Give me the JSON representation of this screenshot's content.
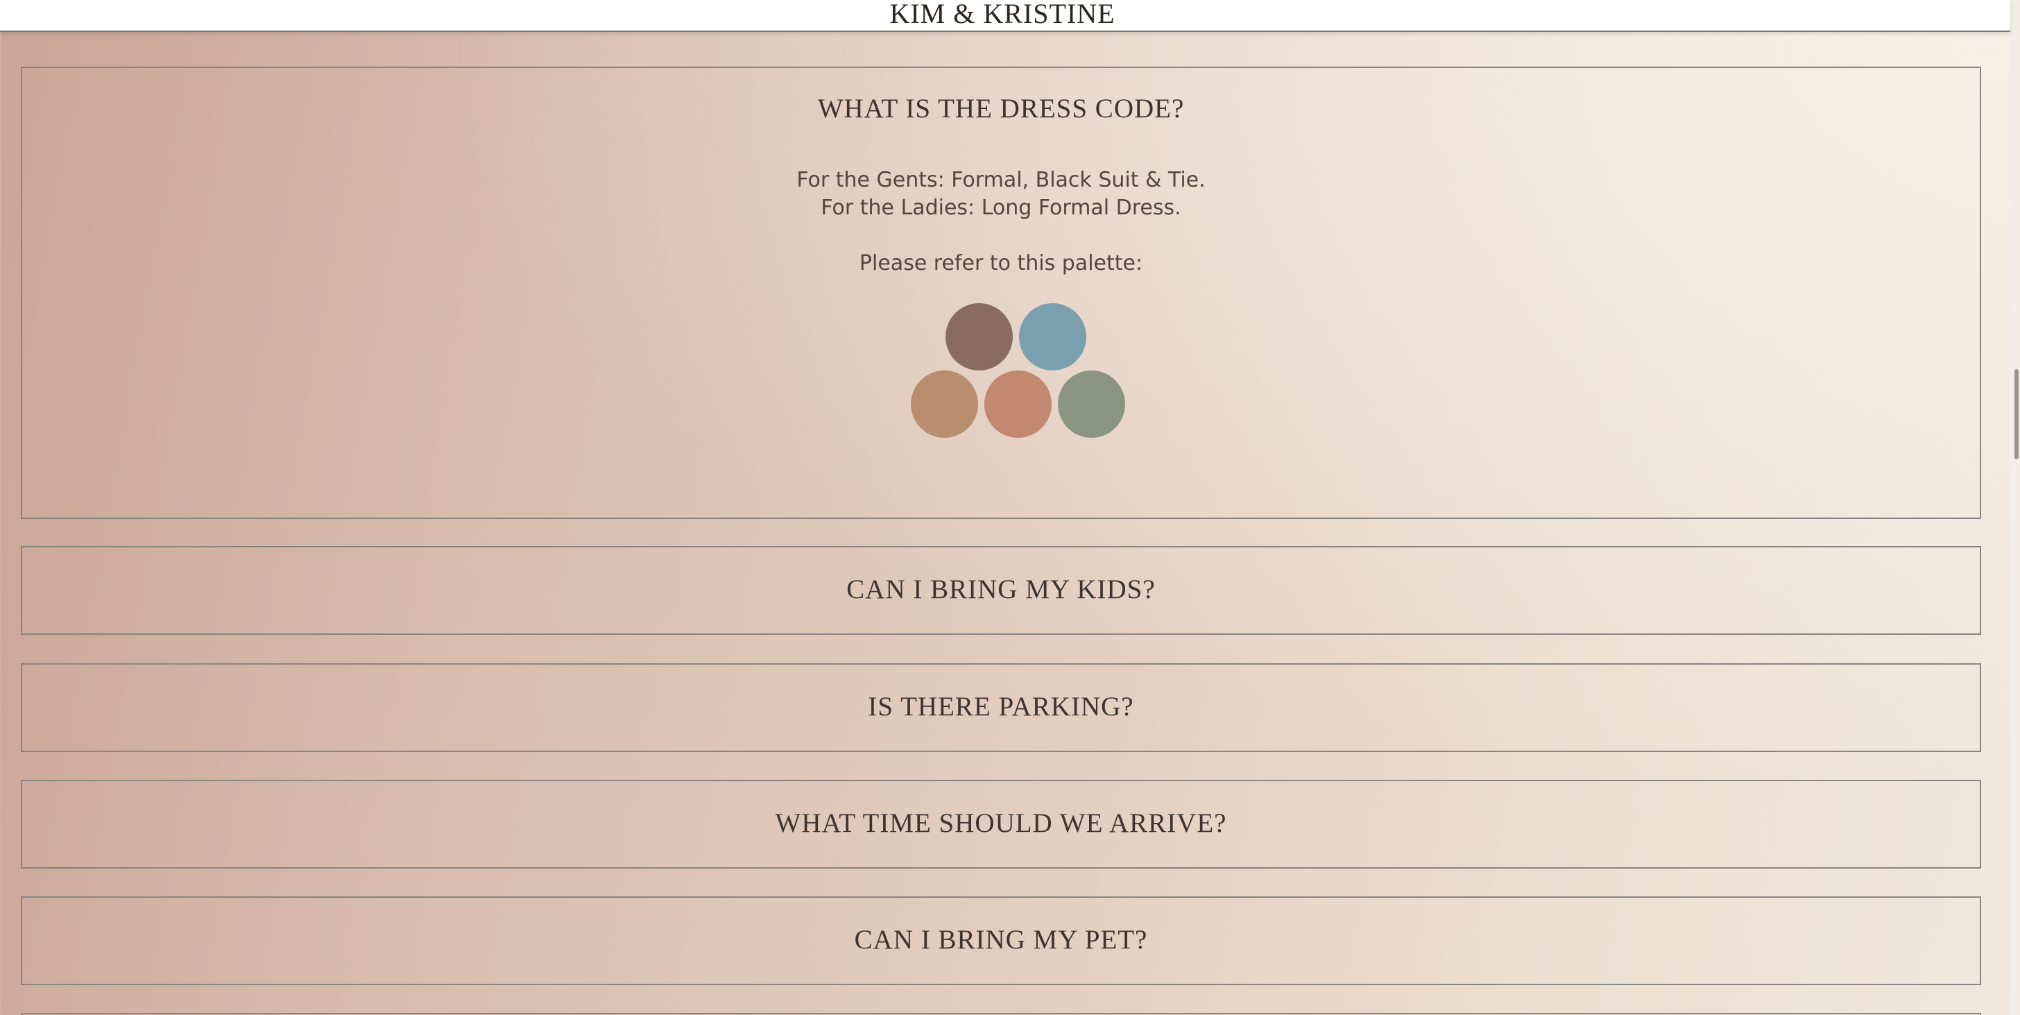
{
  "header": {
    "title": "KIM & KRISTINE"
  },
  "faq": [
    {
      "question": "WHAT IS THE DRESS CODE?",
      "expanded": true,
      "answer_lines": [
        "For the Gents: Formal, Black Suit & Tie.",
        "For the Ladies: Long Formal Dress.",
        "Please refer to this palette:"
      ],
      "palette": [
        "#8a6b5f",
        "#7aa0ad",
        "#b88e6e",
        "#c28970",
        "#8a9481"
      ]
    },
    {
      "question": "CAN I BRING MY KIDS?",
      "expanded": false
    },
    {
      "question": "IS THERE PARKING?",
      "expanded": false
    },
    {
      "question": "WHAT TIME SHOULD WE ARRIVE?",
      "expanded": false
    },
    {
      "question": "CAN I BRING MY PET?",
      "expanded": false
    }
  ]
}
